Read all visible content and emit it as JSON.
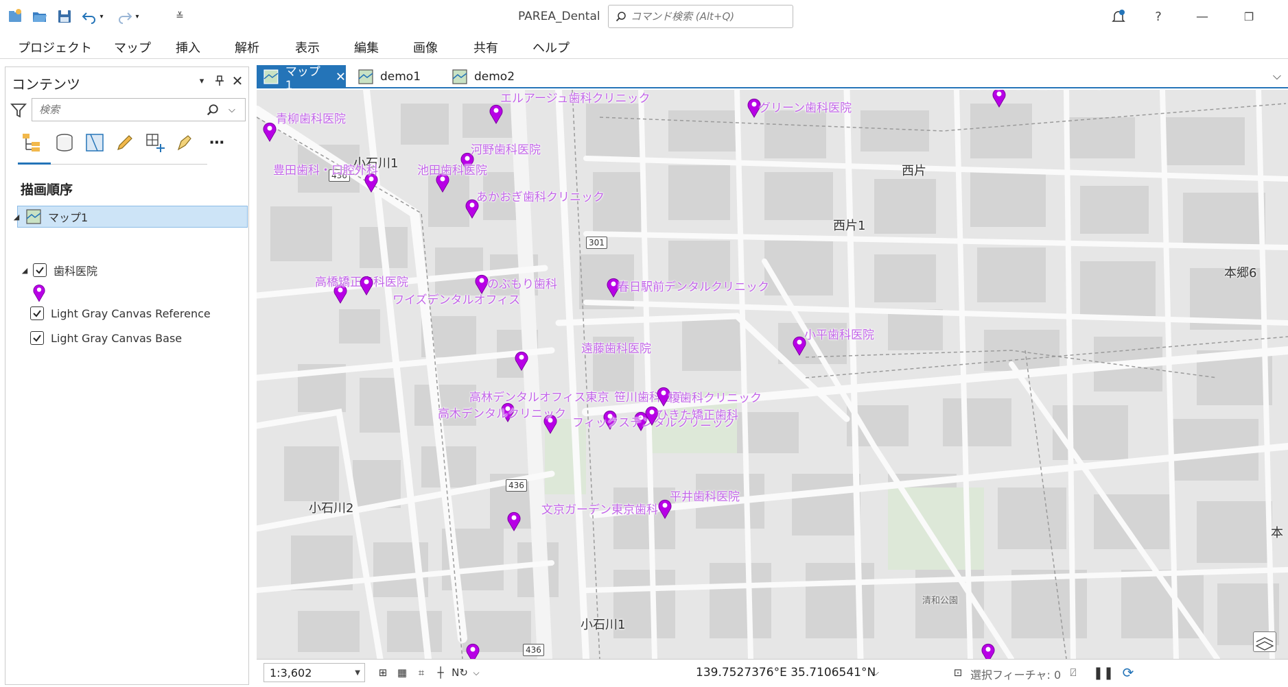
{
  "app": {
    "title": "PAREA_Dental",
    "search_placeholder": "コマンド検索 (Alt+Q)",
    "help": "?"
  },
  "quick_access": [
    "new-project-icon",
    "open-project-icon",
    "save-project-icon",
    "undo-icon",
    "redo-icon",
    "customize-icon"
  ],
  "menu": [
    "プロジェクト",
    "マップ",
    "挿入",
    "解析",
    "表示",
    "編集",
    "画像",
    "共有",
    "ヘルプ"
  ],
  "contents": {
    "title": "コンテンツ",
    "search_placeholder": "検索",
    "draw_order": "描画順序",
    "layers": {
      "map": "マップ1",
      "dental": "歯科医院",
      "reference": "Light Gray Canvas Reference",
      "base": "Light Gray Canvas Base"
    }
  },
  "tabs": [
    "マップ1",
    "demo1",
    "demo2"
  ],
  "map": {
    "places": {
      "koishikawa1_a": "小石川1",
      "nishikata": "西片",
      "nishikata1": "西片1",
      "hongo6": "本郷6",
      "koishikawa2": "小石川2",
      "koishikawa1_b": "小石川1",
      "hon": "本",
      "park": "清和公園"
    },
    "routes": {
      "r436a": "436",
      "r301": "301",
      "r436b": "436",
      "r436c": "436"
    },
    "pois": [
      "青柳歯科医院",
      "エルアージュ歯科クリニック",
      "グリーン歯科医院",
      "東大前ひろた歯科クリニック",
      "河野歯科医院",
      "豊田歯科・口腔外科",
      "池田歯科医院",
      "あかおぎ歯科クリニック",
      "高橋矯正歯科医院",
      "ワイズデンタルオフィス",
      "のぶもり歯科",
      "春日駅前デンタルクリニック",
      "小平歯科医院",
      "遠藤歯科医院",
      "高林デンタルオフィス東京",
      "笹川歯科医院",
      "榎歯科クリニック",
      "高木デンタルクリニック",
      "フィックスデンタルクリニック",
      "ひきた矯正歯科",
      "平井歯科医院",
      "文京ガーデン東京歯科"
    ]
  },
  "status": {
    "scale": "1:3,602",
    "coordinates": "139.7527376°E 35.7106541°N",
    "selected_features": "選択フィーチャ: 0"
  },
  "colors": {
    "accent": "#2474b8",
    "poi": "#b800e6",
    "poi_label": "#c265e8"
  }
}
